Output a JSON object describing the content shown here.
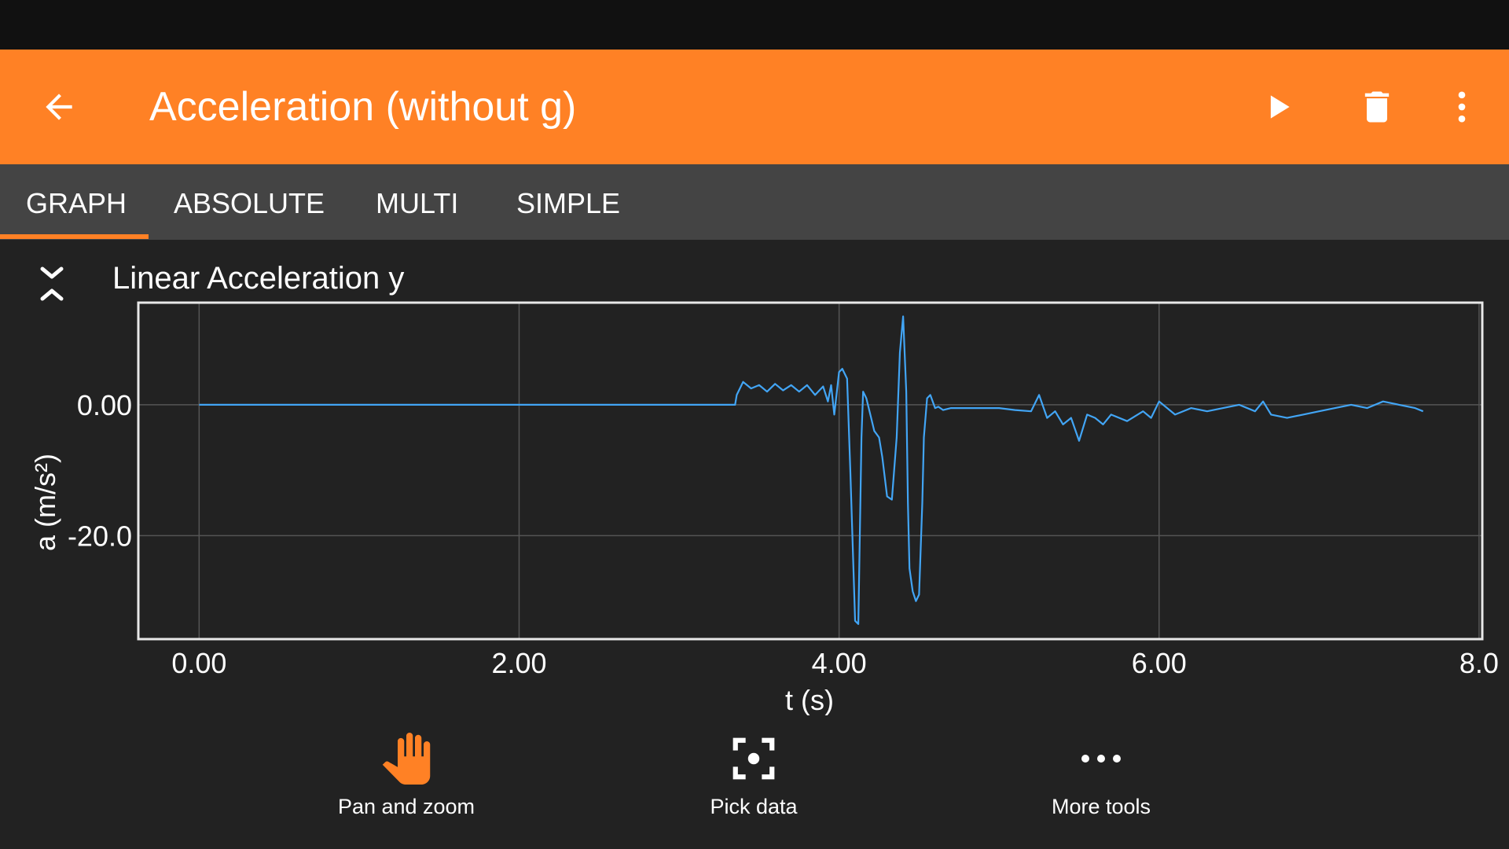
{
  "app": {
    "title": "Acceleration (without g)",
    "accent_color": "#ff8125",
    "icons": [
      "back-arrow-icon",
      "play-icon",
      "trash-icon",
      "more-vert-icon"
    ]
  },
  "tabs": [
    {
      "label": "GRAPH",
      "active": true
    },
    {
      "label": "ABSOLUTE",
      "active": false
    },
    {
      "label": "MULTI",
      "active": false
    },
    {
      "label": "SIMPLE",
      "active": false
    }
  ],
  "graph": {
    "title": "Linear Acceleration y",
    "collapse_icon": "collapse-chevrons-icon"
  },
  "chart_data": {
    "type": "line",
    "xlabel": "t (s)",
    "ylabel": "a (m/s²)",
    "xlim": [
      -0.38,
      8.02
    ],
    "ylim": [
      -35.8,
      15.6
    ],
    "xticks": [
      "0.00",
      "2.00",
      "4.00",
      "6.00",
      "8.0"
    ],
    "xtick_values": [
      0,
      2,
      4,
      6,
      8
    ],
    "yticks": [
      "0.00",
      "-20.0"
    ],
    "ytick_values": [
      0,
      -20
    ],
    "grid": true,
    "line_color": "#42a5f5",
    "series": [
      {
        "x": [
          0.0,
          3.35,
          3.36,
          3.4,
          3.45,
          3.5,
          3.55,
          3.6,
          3.65,
          3.7,
          3.75,
          3.8,
          3.85,
          3.9,
          3.93,
          3.95,
          3.97,
          4.0,
          4.02,
          4.05,
          4.07,
          4.1,
          4.12,
          4.14,
          4.15,
          4.17,
          4.2,
          4.22,
          4.25,
          4.27,
          4.3,
          4.33,
          4.36,
          4.38,
          4.4,
          4.42,
          4.43,
          4.44,
          4.46,
          4.48,
          4.5,
          4.52,
          4.53,
          4.55,
          4.57,
          4.6,
          4.62,
          4.65,
          4.7,
          4.8,
          5.0,
          5.1,
          5.2,
          5.25,
          5.3,
          5.35,
          5.4,
          5.45,
          5.5,
          5.55,
          5.6,
          5.65,
          5.7,
          5.8,
          5.9,
          5.95,
          6.0,
          6.1,
          6.2,
          6.3,
          6.4,
          6.5,
          6.6,
          6.65,
          6.7,
          6.8,
          6.9,
          7.0,
          7.1,
          7.2,
          7.3,
          7.4,
          7.5,
          7.6,
          7.65
        ],
        "y": [
          0.0,
          0.0,
          1.5,
          3.5,
          2.5,
          3.0,
          2.0,
          3.2,
          2.2,
          3.0,
          2.0,
          3.0,
          1.5,
          2.8,
          0.5,
          3.0,
          -1.5,
          5.0,
          5.5,
          4.0,
          -10.0,
          -33.0,
          -33.5,
          -5.0,
          2.0,
          1.0,
          -2.0,
          -4.0,
          -5.0,
          -8.0,
          -14.0,
          -14.5,
          -5.0,
          8.0,
          13.5,
          2.0,
          -15.0,
          -25.0,
          -28.5,
          -30.0,
          -29.0,
          -15.0,
          -5.0,
          1.0,
          1.5,
          -0.5,
          -0.3,
          -0.8,
          -0.5,
          -0.5,
          -0.5,
          -0.8,
          -1.0,
          1.5,
          -2.0,
          -1.0,
          -3.0,
          -2.0,
          -5.5,
          -1.5,
          -2.0,
          -3.0,
          -1.5,
          -2.5,
          -1.0,
          -2.0,
          0.5,
          -1.5,
          -0.5,
          -1.0,
          -0.5,
          0.0,
          -1.0,
          0.5,
          -1.5,
          -2.0,
          -1.5,
          -1.0,
          -0.5,
          0.0,
          -0.5,
          0.5,
          0.0,
          -0.5,
          -1.0
        ]
      }
    ]
  },
  "tools": [
    {
      "label": "Pan and zoom",
      "icon": "hand-icon",
      "active": true
    },
    {
      "label": "Pick data",
      "icon": "pick-data-icon",
      "active": false
    },
    {
      "label": "More tools",
      "icon": "more-horiz-icon",
      "active": false
    }
  ]
}
